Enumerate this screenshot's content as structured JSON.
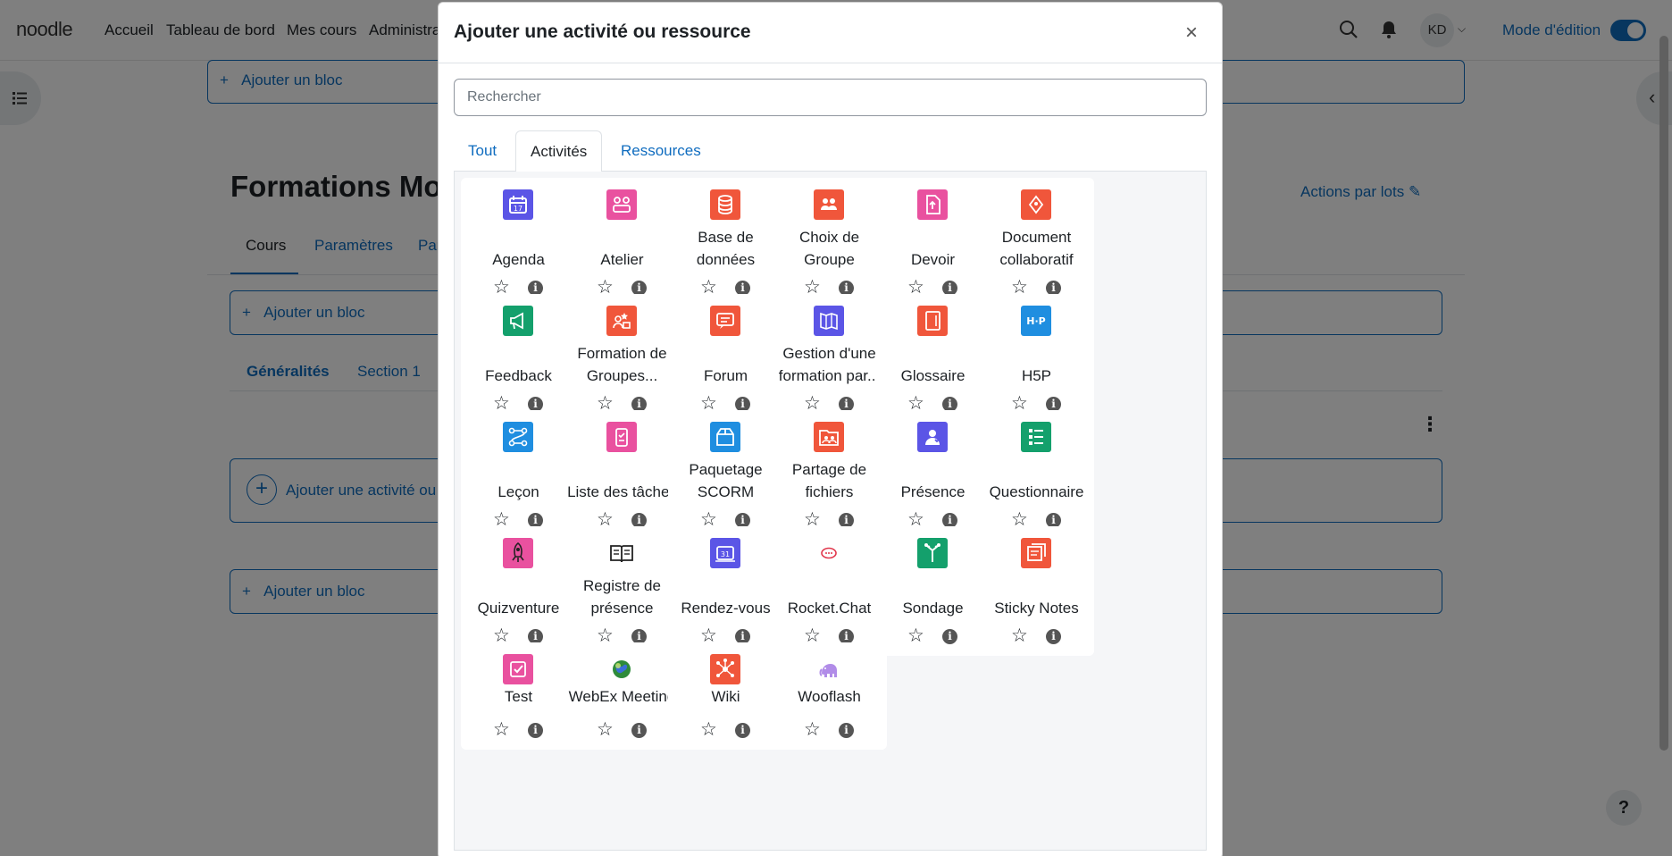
{
  "topnav": {
    "brand": "noodle",
    "links": [
      "Accueil",
      "Tableau de bord",
      "Mes cours",
      "Administra"
    ],
    "avatar_initials": "KD",
    "edit_mode_label": "Mode d'édition"
  },
  "page": {
    "add_block": "Ajouter un bloc",
    "course_title": "Formations Mo",
    "tabs": [
      "Cours",
      "Paramètres",
      "Par"
    ],
    "bulk_actions": "Actions par lots",
    "section_tabs": [
      "Généralités",
      "Section 1"
    ],
    "add_activity": "Ajouter une activité ou",
    "help": "?"
  },
  "modal": {
    "title": "Ajouter une activité ou ressource",
    "close_glyph": "×",
    "search_placeholder": "Rechercher",
    "tabs": [
      "Tout",
      "Activités",
      "Ressources"
    ],
    "active_tab": "Activités",
    "star_glyph": "☆",
    "info_glyph": "i",
    "cards": [
      {
        "label": "Agenda",
        "icon": "calendar-icon",
        "color": "#5b55e6"
      },
      {
        "label": "Atelier",
        "icon": "workshop-icon",
        "color": "#e9519f"
      },
      {
        "label": "Base de données",
        "icon": "database-icon",
        "color": "#f0563b"
      },
      {
        "label": "Choix de Groupe",
        "icon": "group-choice-icon",
        "color": "#f0563b"
      },
      {
        "label": "Devoir",
        "icon": "assignment-icon",
        "color": "#e9519f"
      },
      {
        "label": "Document collaboratif",
        "icon": "collab-doc-icon",
        "color": "#f0563b"
      },
      {
        "label": "Feedback",
        "icon": "megaphone-icon",
        "color": "#14a06c"
      },
      {
        "label": "Formation de Groupes...",
        "icon": "group-formation-icon",
        "color": "#f0563b"
      },
      {
        "label": "Forum",
        "icon": "forum-icon",
        "color": "#f0563b"
      },
      {
        "label": "Gestion d'une formation par...",
        "icon": "training-map-icon",
        "color": "#5b55e6"
      },
      {
        "label": "Glossaire",
        "icon": "glossary-icon",
        "color": "#f0563b"
      },
      {
        "label": "H5P",
        "icon": "h5p-icon",
        "color": "#1f8ee0"
      },
      {
        "label": "Leçon",
        "icon": "lesson-icon",
        "color": "#1f8ee0"
      },
      {
        "label": "Liste des tâches",
        "icon": "checklist-icon",
        "color": "#e9519f"
      },
      {
        "label": "Paquetage SCORM",
        "icon": "scorm-package-icon",
        "color": "#1f8ee0"
      },
      {
        "label": "Partage de fichiers",
        "icon": "file-share-icon",
        "color": "#f0563b"
      },
      {
        "label": "Présence",
        "icon": "attendance-icon",
        "color": "#5b55e6"
      },
      {
        "label": "Questionnaire",
        "icon": "questionnaire-icon",
        "color": "#14a06c"
      },
      {
        "label": "Quizventure",
        "icon": "rocket-icon",
        "color": "#e9519f"
      },
      {
        "label": "Registre de présence",
        "icon": "register-book-icon",
        "color": "#ffffff"
      },
      {
        "label": "Rendez-vous",
        "icon": "appointment-icon",
        "color": "#5b55e6"
      },
      {
        "label": "Rocket.Chat",
        "icon": "rocketchat-icon",
        "color": "#ffffff"
      },
      {
        "label": "Sondage",
        "icon": "survey-icon",
        "color": "#14a06c"
      },
      {
        "label": "Sticky Notes",
        "icon": "sticky-notes-icon",
        "color": "#f0563b"
      },
      {
        "label": "Test",
        "icon": "quiz-check-icon",
        "color": "#e9519f"
      },
      {
        "label": "WebEx Meeting",
        "icon": "webex-globe-icon",
        "color": "#ffffff"
      },
      {
        "label": "Wiki",
        "icon": "wiki-icon",
        "color": "#f0563b"
      },
      {
        "label": "Wooflash",
        "icon": "elephant-icon",
        "color": "#ffffff"
      }
    ]
  }
}
